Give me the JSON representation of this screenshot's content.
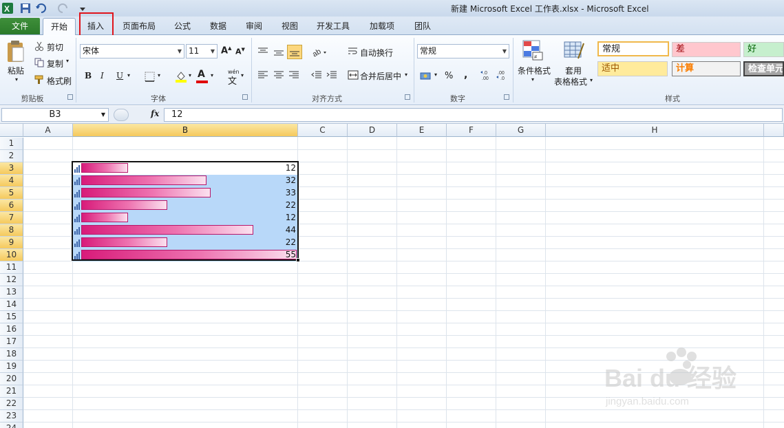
{
  "window": {
    "title": "新建 Microsoft Excel 工作表.xlsx  -  Microsoft Excel"
  },
  "tabs": [
    {
      "label": "文件",
      "id": "file"
    },
    {
      "label": "开始",
      "id": "home"
    },
    {
      "label": "插入",
      "id": "insert"
    },
    {
      "label": "页面布局",
      "id": "page-layout"
    },
    {
      "label": "公式",
      "id": "formulas"
    },
    {
      "label": "数据",
      "id": "data"
    },
    {
      "label": "审阅",
      "id": "review"
    },
    {
      "label": "视图",
      "id": "view"
    },
    {
      "label": "开发工具",
      "id": "developer"
    },
    {
      "label": "加载项",
      "id": "addins"
    },
    {
      "label": "团队",
      "id": "team"
    }
  ],
  "clipboard": {
    "paste": "粘贴",
    "cut": "剪切",
    "copy": "复制",
    "format_painter": "格式刷",
    "label": "剪贴板"
  },
  "font": {
    "name": "宋体",
    "size": "11",
    "bold": "B",
    "italic": "I",
    "underline": "U",
    "label": "字体",
    "color_letter": "A",
    "wen": "wén",
    "wen_char": "文"
  },
  "alignment": {
    "wrap": "自动换行",
    "merge": "合并后居中",
    "label": "对齐方式"
  },
  "number": {
    "format": "常规",
    "percent": "%",
    "comma": ",",
    "label": "数字"
  },
  "styles": {
    "conditional": "条件格式",
    "table_format_1": "套用",
    "table_format_2": "表格格式",
    "label": "样式",
    "cells": [
      {
        "text": "常规",
        "color": "#ffffff"
      },
      {
        "text": "差",
        "color": "#ffc7ce"
      },
      {
        "text": "好",
        "color": "#c6efce"
      },
      {
        "text": "适中",
        "color": "#ffeb9c"
      },
      {
        "text": "计算",
        "color": "#f2f2f2"
      },
      {
        "text": "检查单元",
        "color": "#a5a5a5"
      }
    ]
  },
  "formula_bar": {
    "name_box": "B3",
    "fx": "fx",
    "content": "12"
  },
  "columns": [
    "A",
    "B",
    "C",
    "D",
    "E",
    "F",
    "G",
    "H"
  ],
  "rows": [
    "1",
    "2",
    "3",
    "4",
    "5",
    "6",
    "7",
    "8",
    "9",
    "10",
    "11",
    "12",
    "13",
    "14",
    "15",
    "16",
    "17",
    "18",
    "19",
    "20",
    "21",
    "22",
    "23",
    "24"
  ],
  "data_bars": {
    "max": 55,
    "values": [
      12,
      32,
      33,
      22,
      12,
      44,
      22,
      55
    ],
    "bar_color": "#d81b7a"
  },
  "watermark": {
    "brand": "Bai du 经验",
    "url": "jingyan.baidu.com"
  }
}
